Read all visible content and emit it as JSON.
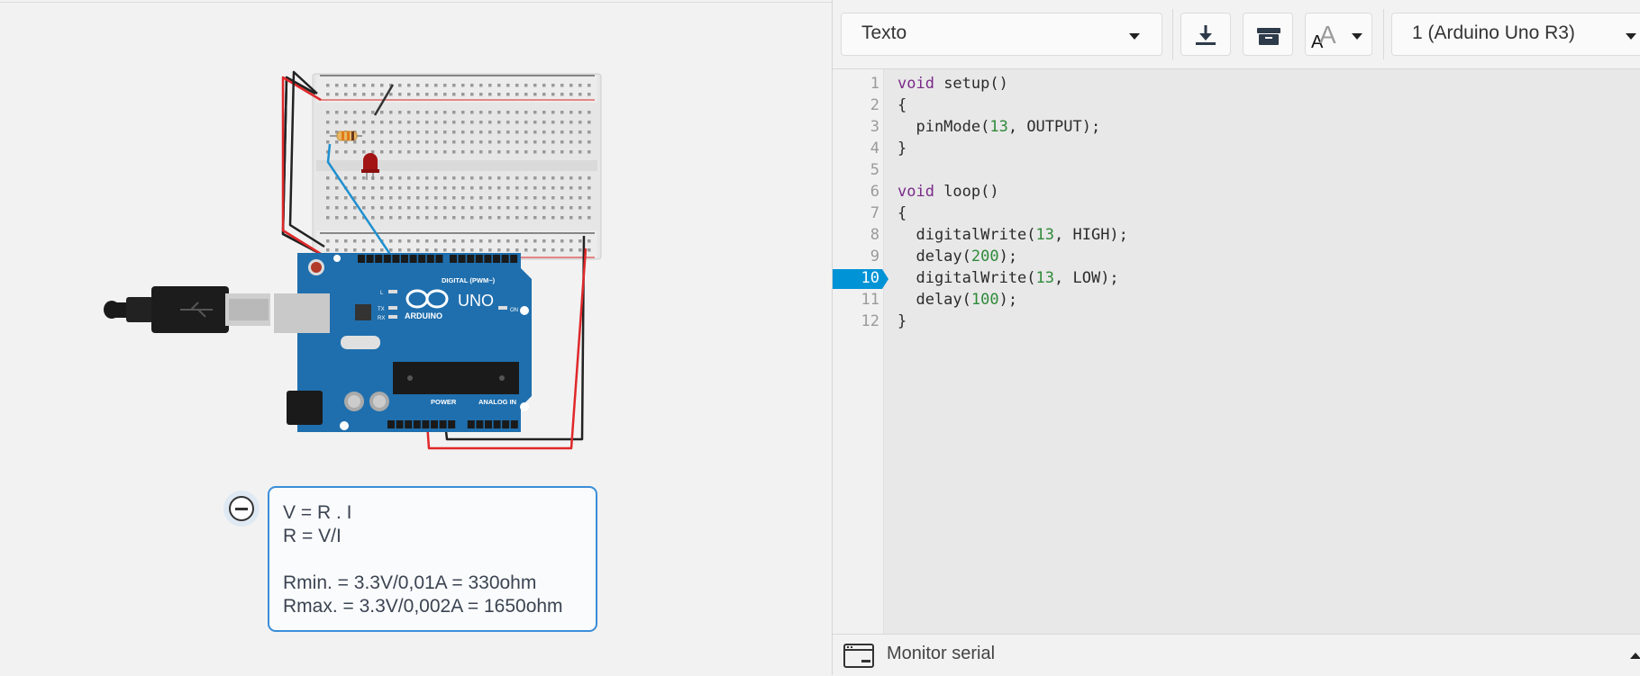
{
  "toolbar": {
    "mode_label": "Texto",
    "board_label": "1 (Arduino Uno R3)",
    "icons": [
      "download-icon",
      "library-icon",
      "font-size-icon"
    ]
  },
  "code": {
    "line_numbers": [
      "1",
      "2",
      "3",
      "4",
      "5",
      "6",
      "7",
      "8",
      "9",
      "10",
      "11",
      "12"
    ],
    "active_line": "10",
    "lines": [
      [
        "kw:void",
        "t: setup()"
      ],
      [
        "t:{"
      ],
      [
        "t:  pinMode(",
        "n:13",
        "t:, OUTPUT);"
      ],
      [
        "t:}"
      ],
      [
        "t:"
      ],
      [
        "kw:void",
        "t: loop()"
      ],
      [
        "t:{"
      ],
      [
        "t:  digitalWrite(",
        "n:13",
        "t:, HIGH);"
      ],
      [
        "t:  delay(",
        "n:200",
        "t:);"
      ],
      [
        "t:  digitalWrite(",
        "n:13",
        "t:, LOW);"
      ],
      [
        "t:  delay(",
        "n:100",
        "t:);"
      ],
      [
        "t:}"
      ]
    ]
  },
  "serial": {
    "label": "Monitor serial"
  },
  "note": {
    "lines": [
      "V = R . I",
      "R = V/I",
      "",
      "Rmin. = 3.3V/0,01A = 330ohm",
      "Rmax. = 3.3V/0,002A = 1650ohm"
    ]
  },
  "board": {
    "logo_text": "ARDUINO",
    "model_text": "UNO",
    "digital_label": "DIGITAL (PWM~)",
    "power_label": "POWER",
    "analog_label": "ANALOG IN",
    "on_label": "ON",
    "tx_label": "TX",
    "rx_label": "RX",
    "l_label": "L"
  },
  "colors": {
    "accent": "#0093d6",
    "board": "#1f6fae",
    "wire_red": "#e0282a",
    "wire_black": "#222222",
    "wire_blue": "#1e90d0",
    "led": "#a31515",
    "note_border": "#3a8ed8"
  }
}
